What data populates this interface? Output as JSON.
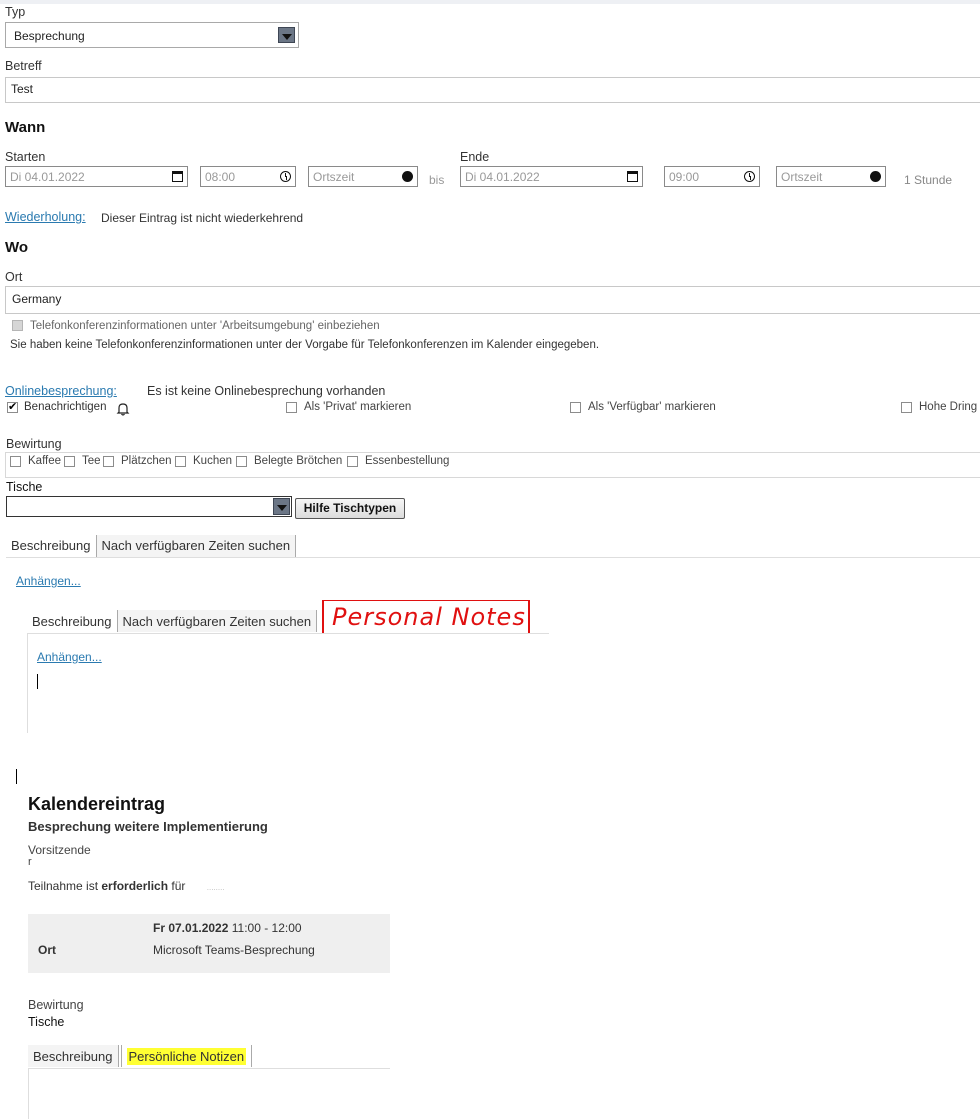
{
  "typ": {
    "label": "Typ",
    "value": "Besprechung"
  },
  "betreff": {
    "label": "Betreff",
    "value": "Test"
  },
  "wann": {
    "heading": "Wann",
    "start": {
      "label": "Starten",
      "date": "Di 04.01.2022",
      "time": "08:00",
      "tz": "Ortszeit"
    },
    "bis": "bis",
    "ende": {
      "label": "Ende",
      "date": "Di 04.01.2022",
      "time": "09:00",
      "tz": "Ortszeit"
    },
    "duration": "1 Stunde",
    "wiederholung_link": "Wiederholung:",
    "wiederholung_text": "Dieser Eintrag ist nicht wiederkehrend"
  },
  "wo": {
    "heading": "Wo",
    "ort_label": "Ort",
    "ort_value": "Germany",
    "telko_checkbox": "Telefonkonferenzinformationen unter 'Arbeitsumgebung' einbeziehen",
    "telko_note": "Sie haben keine Telefonkonferenzinformationen unter der Vorgabe für Telefonkonferenzen im Kalender eingegeben."
  },
  "online": {
    "link": "Onlinebesprechung:",
    "text": "Es ist keine Onlinebesprechung vorhanden"
  },
  "options": {
    "benachrichtigen": "Benachrichtigen",
    "privat": "Als 'Privat' markieren",
    "verfuegbar": "Als 'Verfügbar' markieren",
    "hohe": "Hohe Dring"
  },
  "bewirtung": {
    "label": "Bewirtung",
    "items": [
      "Kaffee",
      "Tee",
      "Plätzchen",
      "Kuchen",
      "Belegte Brötchen",
      "Essenbestellung"
    ]
  },
  "tische": {
    "label": "Tische",
    "value": "",
    "button": "Hilfe Tischtypen"
  },
  "tabs1": {
    "beschreibung": "Beschreibung",
    "zeiten": "Nach verfügbaren Zeiten suchen"
  },
  "anhaengen": "Anhängen...",
  "tabs2": {
    "beschreibung": "Beschreibung",
    "zeiten": "Nach verfügbaren Zeiten suchen"
  },
  "handwritten_annotation": "Personal Notes",
  "anhaengen2": "Anhängen...",
  "kalender": {
    "title": "Kalendereintrag",
    "subtitle": "Besprechung weitere Implementierung",
    "vorsitzende_label": "Vorsitzende",
    "vorsitzende_value": "r",
    "teilnahme_prefix": "Teilnahme ist ",
    "teilnahme_bold": "erforderlich",
    "teilnahme_suffix": " für",
    "teilnahme_name": "........",
    "date": "Fr 07.01.2022",
    "time": "11:00 - 12:00",
    "ort_label": "Ort",
    "ort_value": "Microsoft Teams-Besprechung",
    "bewirtung": "Bewirtung",
    "tische": "Tische",
    "tab_beschreibung": "Beschreibung",
    "tab_notizen": "Persönliche Notizen"
  },
  "colors": {
    "link": "#2a7ab0",
    "annotation": "#e01010",
    "highlight": "#ffff33"
  }
}
